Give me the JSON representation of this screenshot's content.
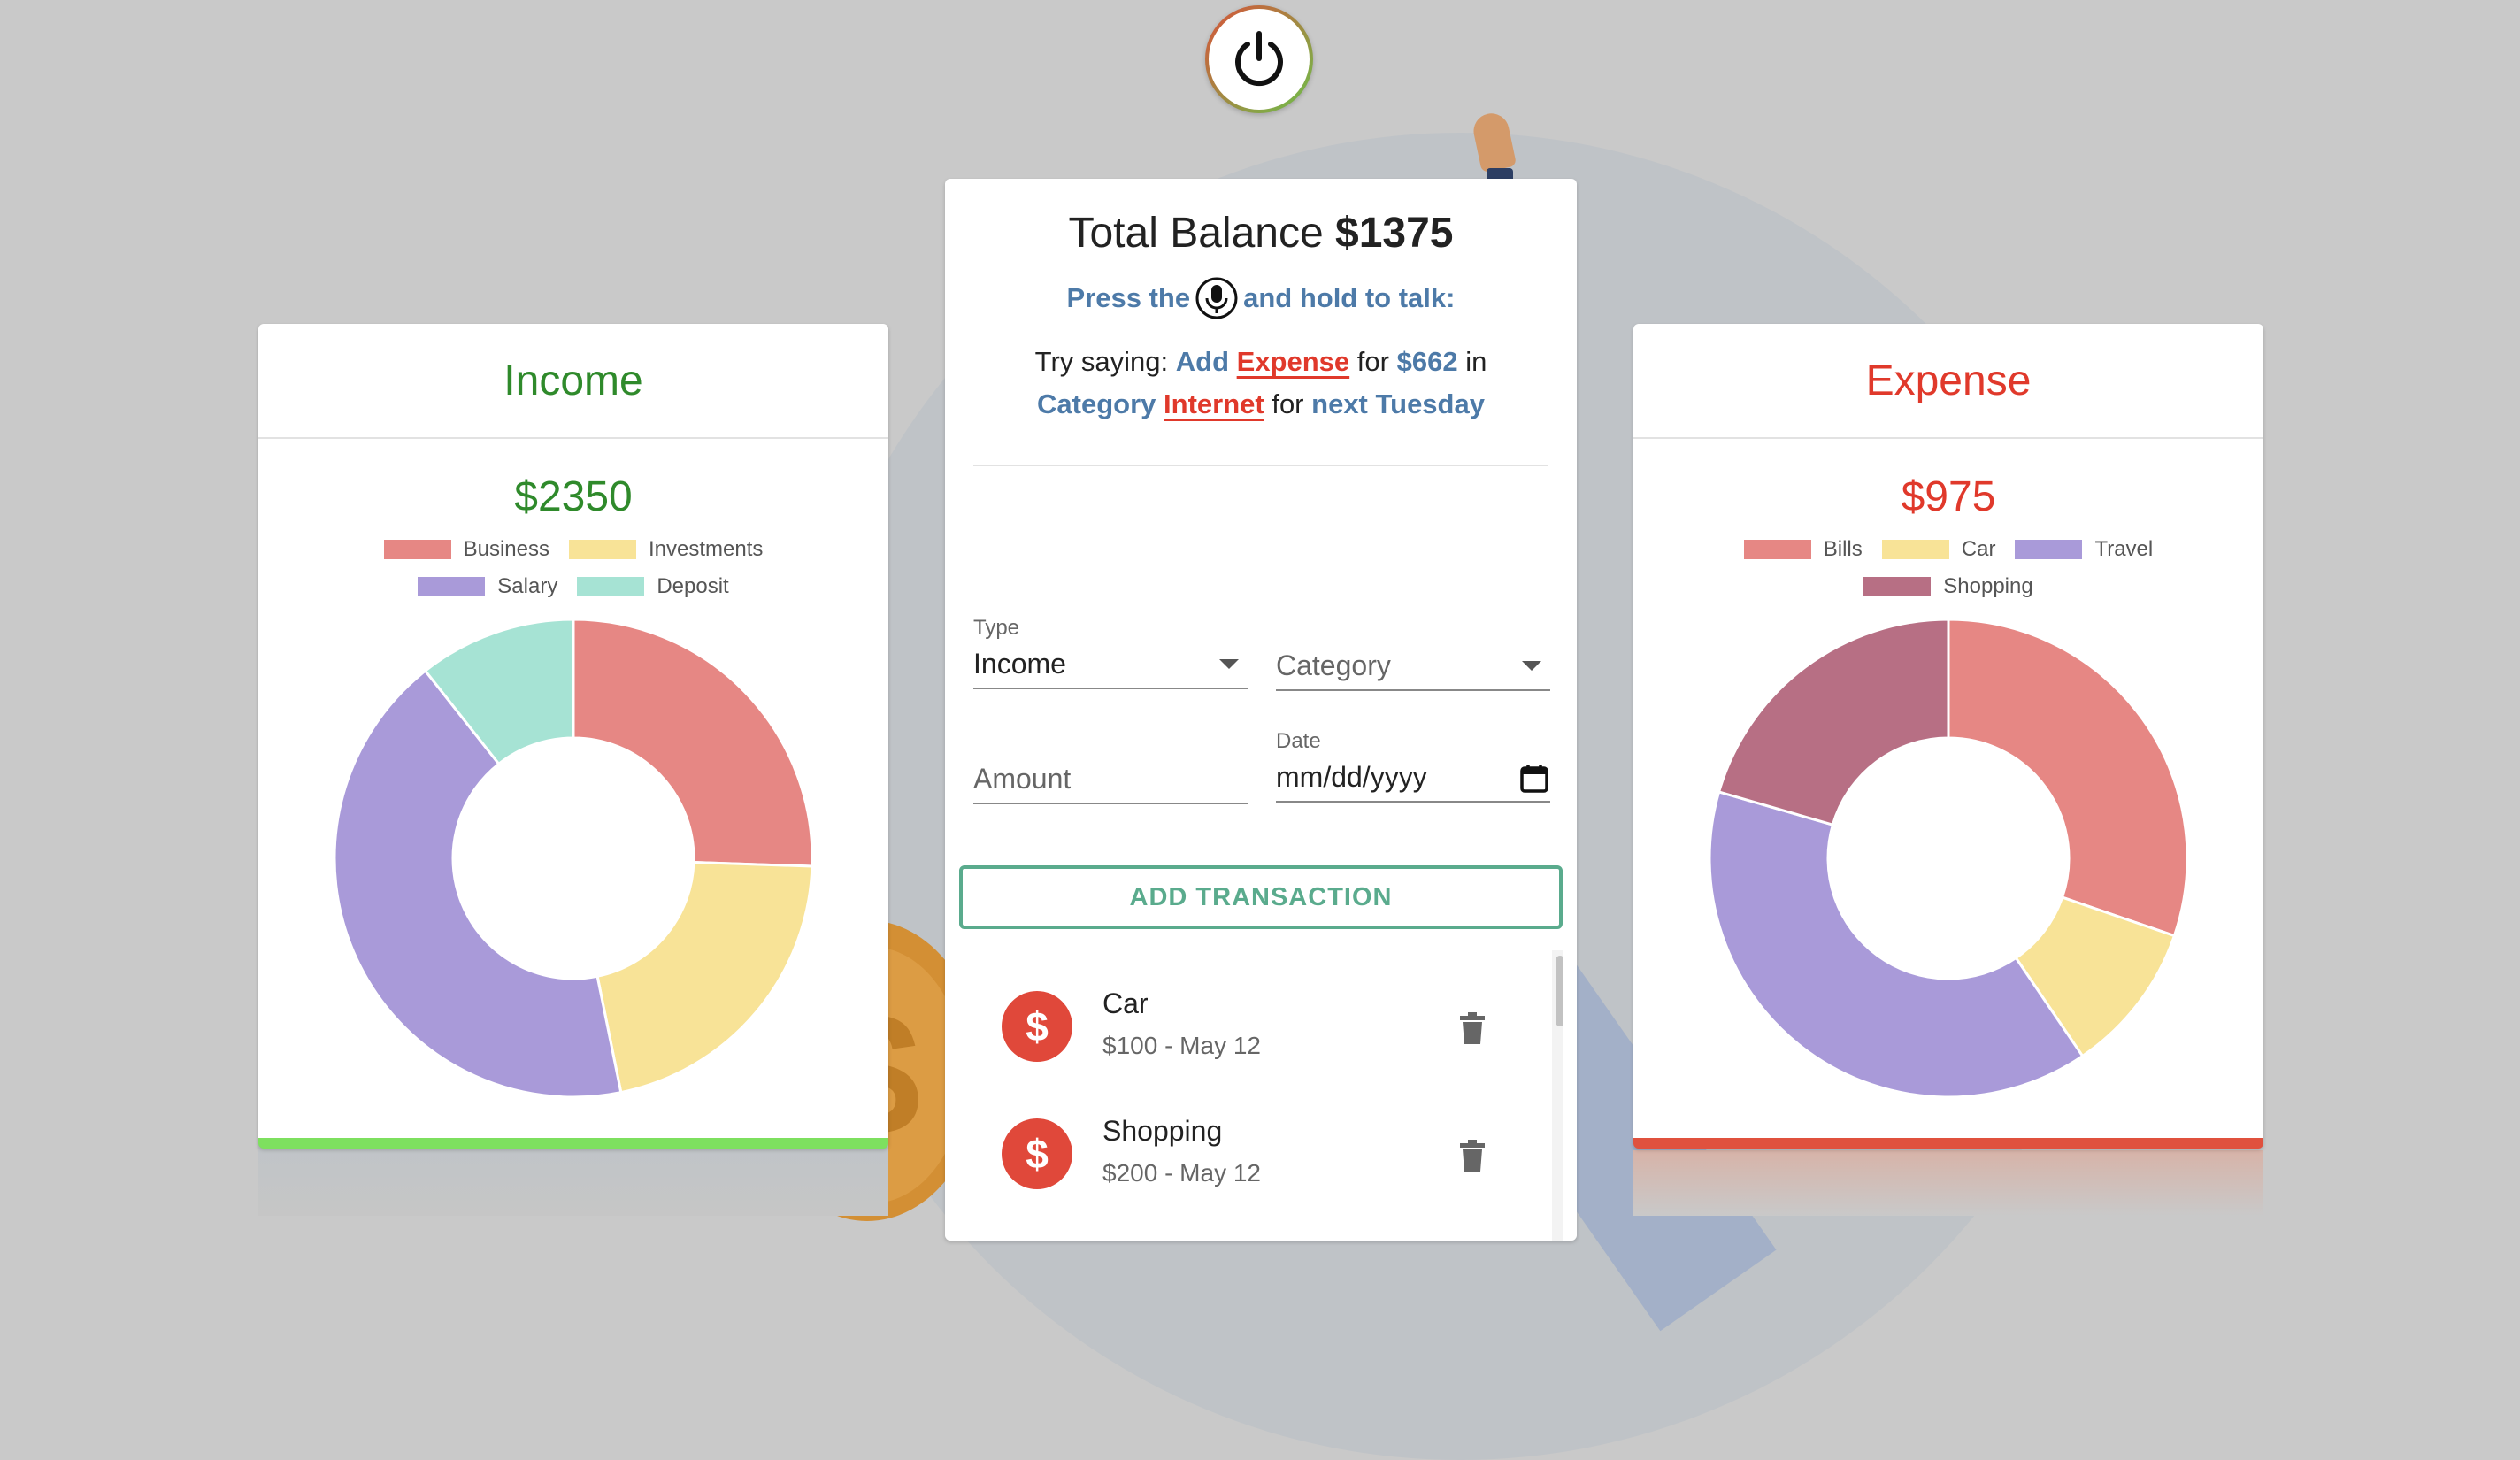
{
  "income": {
    "title": "Income",
    "amount": "$2350",
    "chart_data": {
      "type": "pie",
      "categories": [
        "Business",
        "Investments",
        "Salary",
        "Deposit"
      ],
      "values": [
        600,
        500,
        1000,
        250
      ],
      "colors": [
        "#e68784",
        "#f8e397",
        "#a99ad9",
        "#a6e3d4"
      ],
      "legend_position": "top"
    }
  },
  "expense": {
    "title": "Expense",
    "amount": "$975",
    "chart_data": {
      "type": "pie",
      "categories": [
        "Bills",
        "Car",
        "Travel",
        "Shopping"
      ],
      "values": [
        295,
        100,
        380,
        200
      ],
      "colors": [
        "#e68784",
        "#f8e397",
        "#a99ad9",
        "#b76f84"
      ],
      "legend_position": "top"
    }
  },
  "main": {
    "balance_label": "Total Balance",
    "balance_value": "$1375",
    "press_prefix": "Press the",
    "press_suffix": "and hold to talk:",
    "hint": {
      "t1": "Try saying:",
      "k1": "Add",
      "k2": "Expense",
      "t2": "for",
      "k3": "$662",
      "t3": "in",
      "k4": "Category",
      "k5": "Internet",
      "t4": "for",
      "k6": "next Tuesday"
    },
    "form": {
      "type_label": "Type",
      "type_value": "Income",
      "category_placeholder": "Category",
      "amount_placeholder": "Amount",
      "date_label": "Date",
      "date_placeholder": "mm/dd/yyyy"
    },
    "add_button": "ADD TRANSACTION",
    "transactions": [
      {
        "title": "Car",
        "subtitle": "$100 - May 12",
        "icon": "dollar-icon"
      },
      {
        "title": "Shopping",
        "subtitle": "$200 - May 12",
        "icon": "dollar-icon"
      }
    ]
  },
  "colors": {
    "income": "#2f8a2b",
    "expense": "#e0392b",
    "accent": "#4d7aa8",
    "button": "#5aab8d"
  }
}
